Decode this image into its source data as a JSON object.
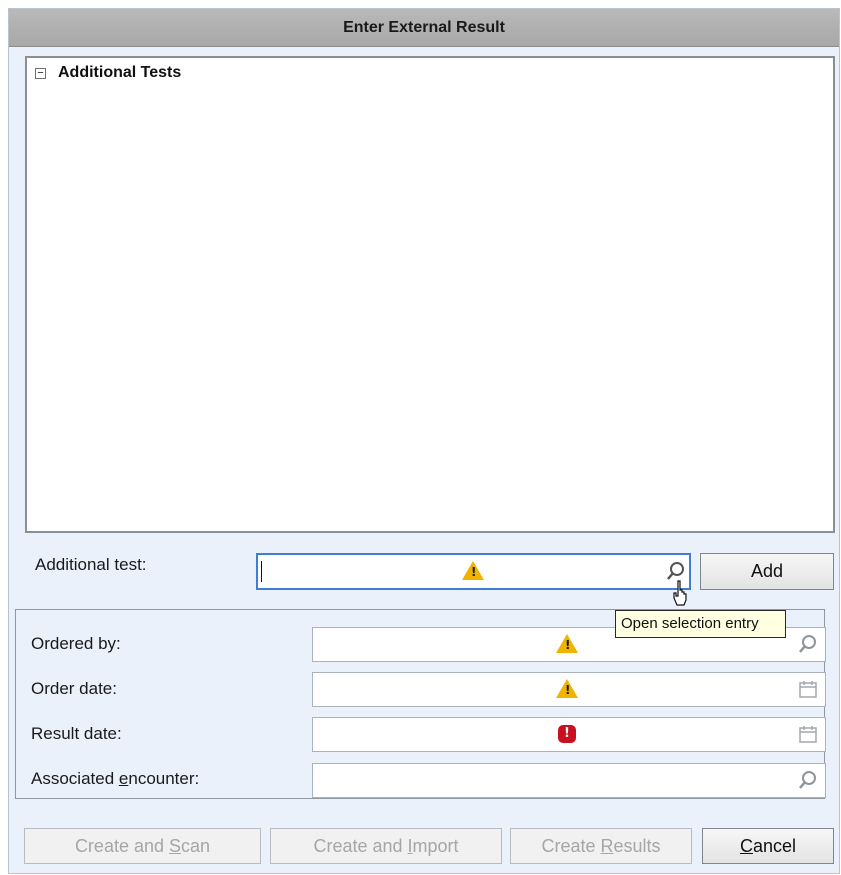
{
  "window": {
    "title": "Enter External Result"
  },
  "tree": {
    "node_label": "Additional Tests",
    "expander": "−"
  },
  "additional_test": {
    "label": "Additional test:",
    "value": "",
    "tooltip": "Open selection entry"
  },
  "add_button": {
    "label": "Add"
  },
  "fields": {
    "ordered_by": {
      "label": "Ordered by:"
    },
    "order_date": {
      "label": "Order date:"
    },
    "result_date": {
      "label": "Result date:"
    },
    "associated_encounter": {
      "label_pre": "Associated ",
      "label_ul": "e",
      "label_post": "ncounter:"
    }
  },
  "buttons": {
    "create_scan": {
      "pre": "Create and ",
      "ul": "S",
      "post": "can"
    },
    "create_import": {
      "pre": "Create and ",
      "ul": "I",
      "post": "mport"
    },
    "create_results": {
      "pre": "Create ",
      "ul": "R",
      "post": "esults"
    },
    "cancel": {
      "pre": "",
      "ul": "C",
      "post": "ancel"
    }
  },
  "colors": {
    "accent": "#3f7ed6",
    "warning": "#f0b400",
    "error": "#c8101e",
    "tooltip_bg": "#ffffe1"
  },
  "icons": [
    "warning-icon",
    "error-icon",
    "search-icon",
    "calendar-icon",
    "hand-cursor"
  ]
}
